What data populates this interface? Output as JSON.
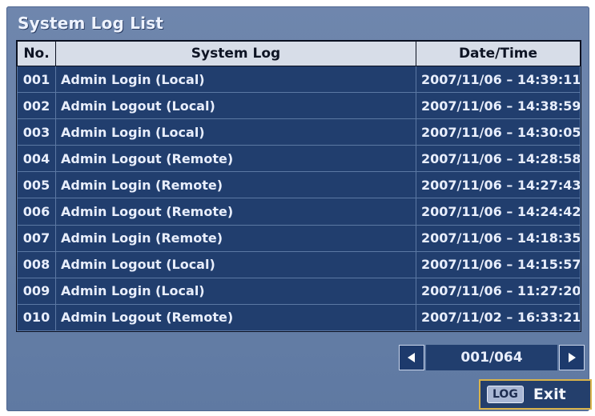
{
  "window": {
    "title": "System Log List"
  },
  "table": {
    "headers": [
      "No.",
      "System Log",
      "Date/Time"
    ],
    "rows": [
      {
        "no": "001",
        "log": "Admin Login (Local)",
        "datetime": "2007/11/06 – 14:39:11"
      },
      {
        "no": "002",
        "log": "Admin Logout (Local)",
        "datetime": "2007/11/06 – 14:38:59"
      },
      {
        "no": "003",
        "log": "Admin Login (Local)",
        "datetime": "2007/11/06 – 14:30:05"
      },
      {
        "no": "004",
        "log": "Admin Logout (Remote)",
        "datetime": "2007/11/06 – 14:28:58"
      },
      {
        "no": "005",
        "log": "Admin Login (Remote)",
        "datetime": "2007/11/06 – 14:27:43"
      },
      {
        "no": "006",
        "log": "Admin Logout (Remote)",
        "datetime": "2007/11/06 – 14:24:42"
      },
      {
        "no": "007",
        "log": "Admin Login (Remote)",
        "datetime": "2007/11/06 – 14:18:35"
      },
      {
        "no": "008",
        "log": "Admin Logout (Local)",
        "datetime": "2007/11/06 – 14:15:57"
      },
      {
        "no": "009",
        "log": "Admin Login (Local)",
        "datetime": "2007/11/06 – 11:27:20"
      },
      {
        "no": "010",
        "log": "Admin Logout (Remote)",
        "datetime": "2007/11/02 – 16:33:21"
      }
    ]
  },
  "pager": {
    "page_text": "001/064",
    "prev_icon": "triangle-left-icon",
    "next_icon": "triangle-right-icon"
  },
  "footer": {
    "log_key_label": "LOG",
    "exit_label": "Exit"
  },
  "colors": {
    "panel": "#6781a8",
    "row": "#213e6e",
    "header": "#d7dde8",
    "exit_border": "#d9b34a"
  }
}
